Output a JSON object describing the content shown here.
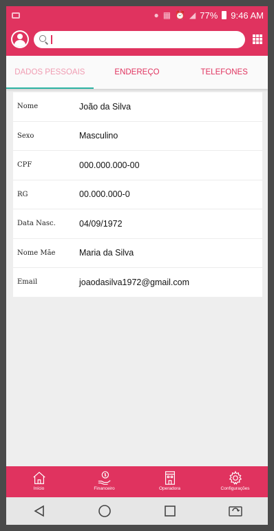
{
  "status_bar": {
    "battery_percent": "77%",
    "time": "9:46 AM"
  },
  "app_bar": {
    "search": {
      "value": "",
      "placeholder": ""
    }
  },
  "tabs": [
    {
      "label": "DADOS PESSOAIS",
      "active": true
    },
    {
      "label": "ENDEREÇO",
      "active": false
    },
    {
      "label": "TELEFONES",
      "active": false
    }
  ],
  "personal_data": [
    {
      "label": "Nome",
      "value": "João da Silva"
    },
    {
      "label": "Sexo",
      "value": "Masculino"
    },
    {
      "label": "CPF",
      "value": "000.000.000-00"
    },
    {
      "label": "RG",
      "value": "00.000.000-0"
    },
    {
      "label": "Data Nasc.",
      "value": "04/09/1972"
    },
    {
      "label": "Nome Mãe",
      "value": "Maria da Silva"
    },
    {
      "label": "Email",
      "value": "joaodasilva1972@gmail.com"
    }
  ],
  "bottom_nav": [
    {
      "label": "Início",
      "icon": "home-icon"
    },
    {
      "label": "Financeiro",
      "icon": "money-hand-icon"
    },
    {
      "label": "Operadora",
      "icon": "building-icon"
    },
    {
      "label": "Configurações",
      "icon": "gear-icon"
    }
  ],
  "system_nav": {
    "buttons": [
      "back-icon",
      "home-circle-icon",
      "recents-icon",
      "screen-rotate-icon"
    ]
  },
  "colors": {
    "accent": "#e0335f",
    "tab_indicator": "#2bb3a3",
    "background": "#eeeeee"
  }
}
